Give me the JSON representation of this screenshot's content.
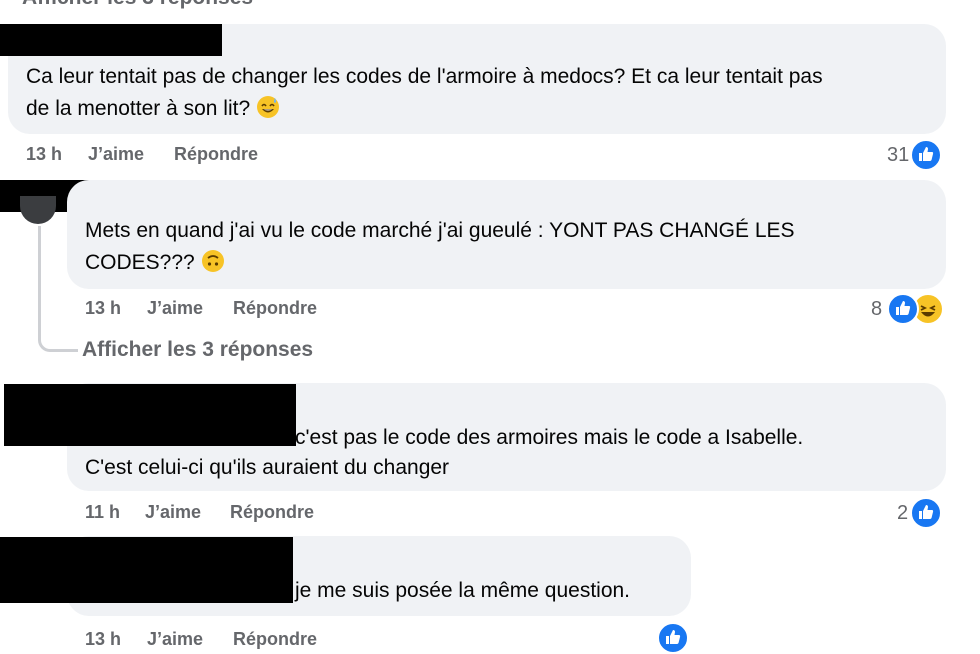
{
  "top_link": "Afficher les 3 réponses",
  "comments": [
    {
      "text_line1": "Ca leur tentait pas de changer les codes de l'armoire à medocs? Et ca leur tentait pas",
      "text_line2": "de la menotter à son lit?",
      "emoji": "grinning-sweat-emoji",
      "time": "13 h",
      "like_label": "J’aime",
      "reply_label": "Répondre",
      "reaction_count": "31"
    },
    {
      "text_line1": "Mets en quand j'ai vu le code marché j'ai gueulé : YONT PAS CHANGÉ LES",
      "text_line2": "CODES???",
      "emoji": "upside-down-face-emoji",
      "time": "13 h",
      "like_label": "J’aime",
      "reply_label": "Répondre",
      "reaction_count": "8",
      "view_replies": "Afficher les 3 réponses"
    },
    {
      "text_line1": "c'est pas le code des armoires mais le code a Isabelle.",
      "text_line2": "C'est celui-ci qu'ils auraient du changer",
      "time": "11 h",
      "like_label": "J’aime",
      "reply_label": "Répondre",
      "reaction_count": "2"
    },
    {
      "text_line1": "je me suis posée la même question.",
      "time": "13 h",
      "like_label": "J’aime",
      "reply_label": "Répondre"
    }
  ],
  "colors": {
    "bubble": "#f0f2f5",
    "meta_text": "#65676b",
    "like_blue": "#1877f2",
    "haha_yellow": "#f7c326"
  }
}
